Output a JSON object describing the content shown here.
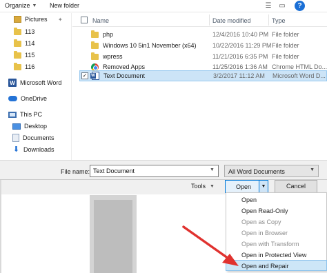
{
  "toolbar": {
    "organize_label": "Organize",
    "new_folder_label": "New folder",
    "help_label": "?"
  },
  "nav": {
    "items": [
      {
        "label": "Pictures",
        "icon": "pictures-folder-icon"
      },
      {
        "label": "113",
        "icon": "folder-icon"
      },
      {
        "label": "114",
        "icon": "folder-icon"
      },
      {
        "label": "115",
        "icon": "folder-icon"
      },
      {
        "label": "116",
        "icon": "folder-icon"
      },
      {
        "label": "Microsoft Word",
        "icon": "word-icon"
      },
      {
        "label": "OneDrive",
        "icon": "onedrive-icon"
      },
      {
        "label": "This PC",
        "icon": "this-pc-icon"
      },
      {
        "label": "Desktop",
        "icon": "desktop-icon"
      },
      {
        "label": "Documents",
        "icon": "documents-icon"
      },
      {
        "label": "Downloads",
        "icon": "downloads-icon"
      }
    ]
  },
  "list": {
    "columns": {
      "name": "Name",
      "date": "Date modified",
      "type": "Type"
    },
    "rows": [
      {
        "name": "php",
        "date": "12/4/2016 10:40 PM",
        "type": "File folder",
        "icon": "folder-icon"
      },
      {
        "name": "Windows 10 5in1 November (x64)",
        "date": "10/22/2016 11:29 PM",
        "type": "File folder",
        "icon": "folder-icon"
      },
      {
        "name": "wpress",
        "date": "11/21/2016 6:35 PM",
        "type": "File folder",
        "icon": "folder-icon"
      },
      {
        "name": "Removed Apps",
        "date": "11/25/2016 1:36 AM",
        "type": "Chrome HTML Do...",
        "icon": "chrome-icon"
      },
      {
        "name": "Text Document",
        "date": "3/2/2017 11:12 AM",
        "type": "Microsoft Word D...",
        "icon": "word-document-icon",
        "selected": true
      }
    ]
  },
  "bottom": {
    "file_name_label": "File name:",
    "file_name_value": "Text Document",
    "filter_value": "All Word Documents",
    "tools_label": "Tools",
    "open_label": "Open",
    "cancel_label": "Cancel"
  },
  "open_menu": {
    "items": [
      {
        "label": "Open",
        "enabled": true
      },
      {
        "label": "Open Read-Only",
        "enabled": true
      },
      {
        "label": "Open as Copy",
        "enabled": false
      },
      {
        "label": "Open in Browser",
        "enabled": false
      },
      {
        "label": "Open with Transform",
        "enabled": false
      },
      {
        "label": "Open in Protected View",
        "enabled": true
      },
      {
        "label": "Open and Repair",
        "enabled": true,
        "highlighted": true
      }
    ]
  },
  "colors": {
    "accent": "#0078d7",
    "selection": "#cce4f7",
    "arrow": "#e0322f"
  }
}
